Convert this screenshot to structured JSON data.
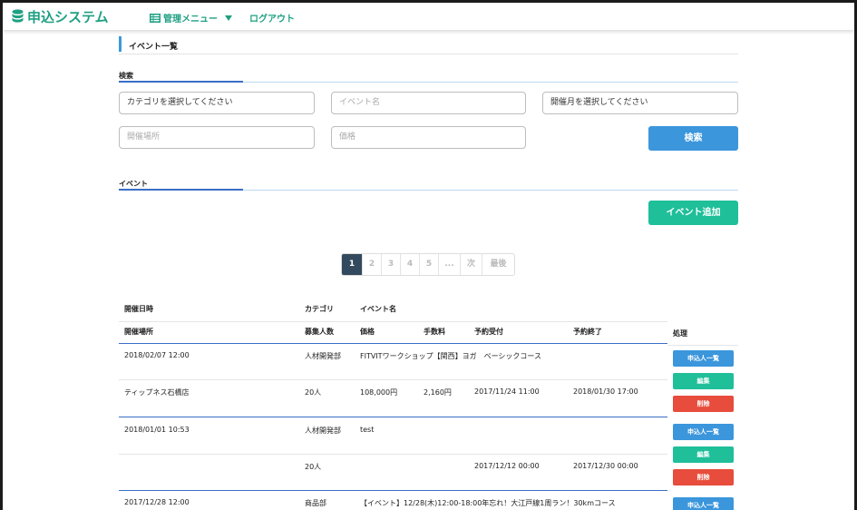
{
  "nav": {
    "brand": "申込システム",
    "menu_label": "管理メニュー",
    "logout_label": "ログアウト"
  },
  "page": {
    "title": "イベント一覧"
  },
  "search": {
    "heading": "検索",
    "category_select": "カテゴリを選択してください",
    "event_name_placeholder": "イベント名",
    "month_select": "開催月を選択してください",
    "venue_placeholder": "開催場所",
    "price_placeholder": "価格",
    "search_button": "検索"
  },
  "events": {
    "heading": "イベント",
    "add_button": "イベント追加"
  },
  "pagination": [
    "1",
    "2",
    "3",
    "4",
    "5",
    "...",
    "次",
    "最後"
  ],
  "table": {
    "headers_row1": {
      "datetime": "開催日時",
      "category": "カテゴリ",
      "event_name": "イベント名"
    },
    "headers_row2": {
      "venue": "開催場所",
      "capacity": "募集人数",
      "price": "価格",
      "fee": "手数料",
      "booking_start": "予約受付",
      "booking_end": "予約終了",
      "actions": "処理"
    },
    "action_labels": {
      "applicants": "申込人一覧",
      "edit": "編集",
      "delete": "削除"
    },
    "rows": [
      {
        "datetime": "2018/02/07 12:00",
        "category": "人材開発部",
        "event_name": "FITVITワークショップ【関西】ヨガ　ベーシックコース",
        "venue": "ティップネス石橋店",
        "capacity": "20人",
        "price": "108,000円",
        "fee": "2,160円",
        "booking_start": "2017/11/24 11:00",
        "booking_end": "2018/01/30 17:00"
      },
      {
        "datetime": "2018/01/01 10:53",
        "category": "人材開発部",
        "event_name": "test",
        "venue": "",
        "capacity": "20人",
        "price": "",
        "fee": "",
        "booking_start": "2017/12/12 00:00",
        "booking_end": "2017/12/30 00:00"
      },
      {
        "datetime": "2017/12/28 12:00",
        "category": "商品部",
        "event_name": "【イベント】12/28(木)12:00-18:00年忘れ！大江戸線1周ラン！30kmコース"
      }
    ]
  },
  "colors": {
    "brand_green": "#1fa083",
    "primary_blue": "#3b96dc",
    "success_teal": "#1fbf9a",
    "danger_red": "#e74c3c",
    "pagination_active": "#33495e"
  }
}
